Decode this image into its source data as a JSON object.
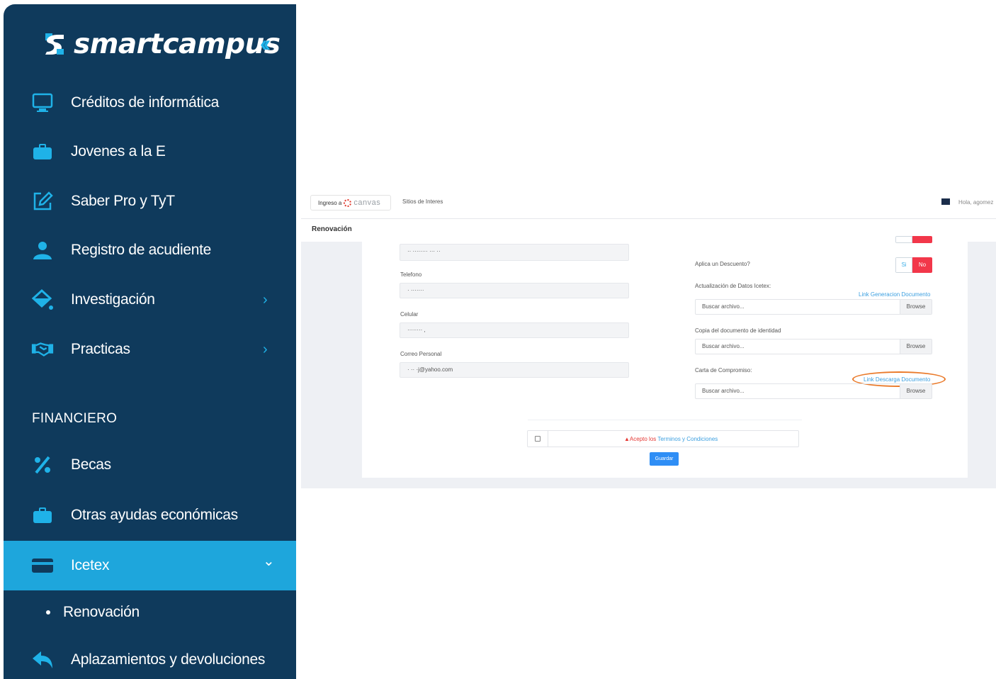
{
  "sidebar": {
    "brand": "smartcampus",
    "collapse_icon": "double-chevron-left-icon",
    "items": [
      {
        "label": "Créditos de informática",
        "icon": "monitor-icon"
      },
      {
        "label": "Jovenes a la E",
        "icon": "briefcase-icon"
      },
      {
        "label": "Saber Pro y TyT",
        "icon": "edit-icon"
      },
      {
        "label": "Registro de acudiente",
        "icon": "user-icon"
      },
      {
        "label": "Investigación",
        "icon": "flask-icon",
        "chevron": "›"
      },
      {
        "label": "Practicas",
        "icon": "handshake-icon",
        "chevron": "›"
      }
    ],
    "section_title": "FINANCIERO",
    "financiero": [
      {
        "label": "Becas",
        "icon": "percent-icon"
      },
      {
        "label": "Otras ayudas económicas",
        "icon": "briefcase-icon"
      },
      {
        "label": "Icetex",
        "icon": "credit-card-icon",
        "chevron": "⌄",
        "active": true
      },
      {
        "label": "Renovación"
      },
      {
        "label": "Aplazamientos y devoluciones",
        "icon": "reply-icon"
      }
    ],
    "colors": {
      "bg": "#0f3a5c",
      "active": "#1ea6dc",
      "accent": "#1fb2e8"
    }
  },
  "screenshot": {
    "topbar": {
      "canvas_prefix": "Ingreso a",
      "canvas_word": "canvas",
      "sitios": "Sitios de Interes",
      "user": "Hola, agomez"
    },
    "breadcrumb": "Renovación",
    "left_fields": [
      {
        "label": "",
        "value": "·· ········ ··· ··"
      },
      {
        "label": "Telefono",
        "value": "· ·······"
      },
      {
        "label": "Celular",
        "value": "········ ,"
      },
      {
        "label": "Correo Personal",
        "value": "·  ··  ·j@yahoo.com"
      }
    ],
    "right": {
      "descuento_label": "Aplica un Descuento?",
      "toggle_si": "Si",
      "toggle_no": "No",
      "actualizacion_label": "Actualización de Datos Icetex:",
      "link_generacion": "Link Generacion Documento",
      "copia_label": "Copia del documento de identidad",
      "carta_label": "Carta de Compromiso:",
      "link_descarga": "Link Descarga Documento",
      "file_placeholder": "Buscar archivo...",
      "browse": "Browse"
    },
    "terms": {
      "warn_icon": "▲",
      "prefix": "Acepto los ",
      "link": "Terminos y Condiciones"
    },
    "submit": "Guardar",
    "colors": {
      "no": "#f2374a",
      "link": "#3b9fe0",
      "highlight": "#ea7a2a",
      "submit": "#2f8ef5"
    }
  }
}
